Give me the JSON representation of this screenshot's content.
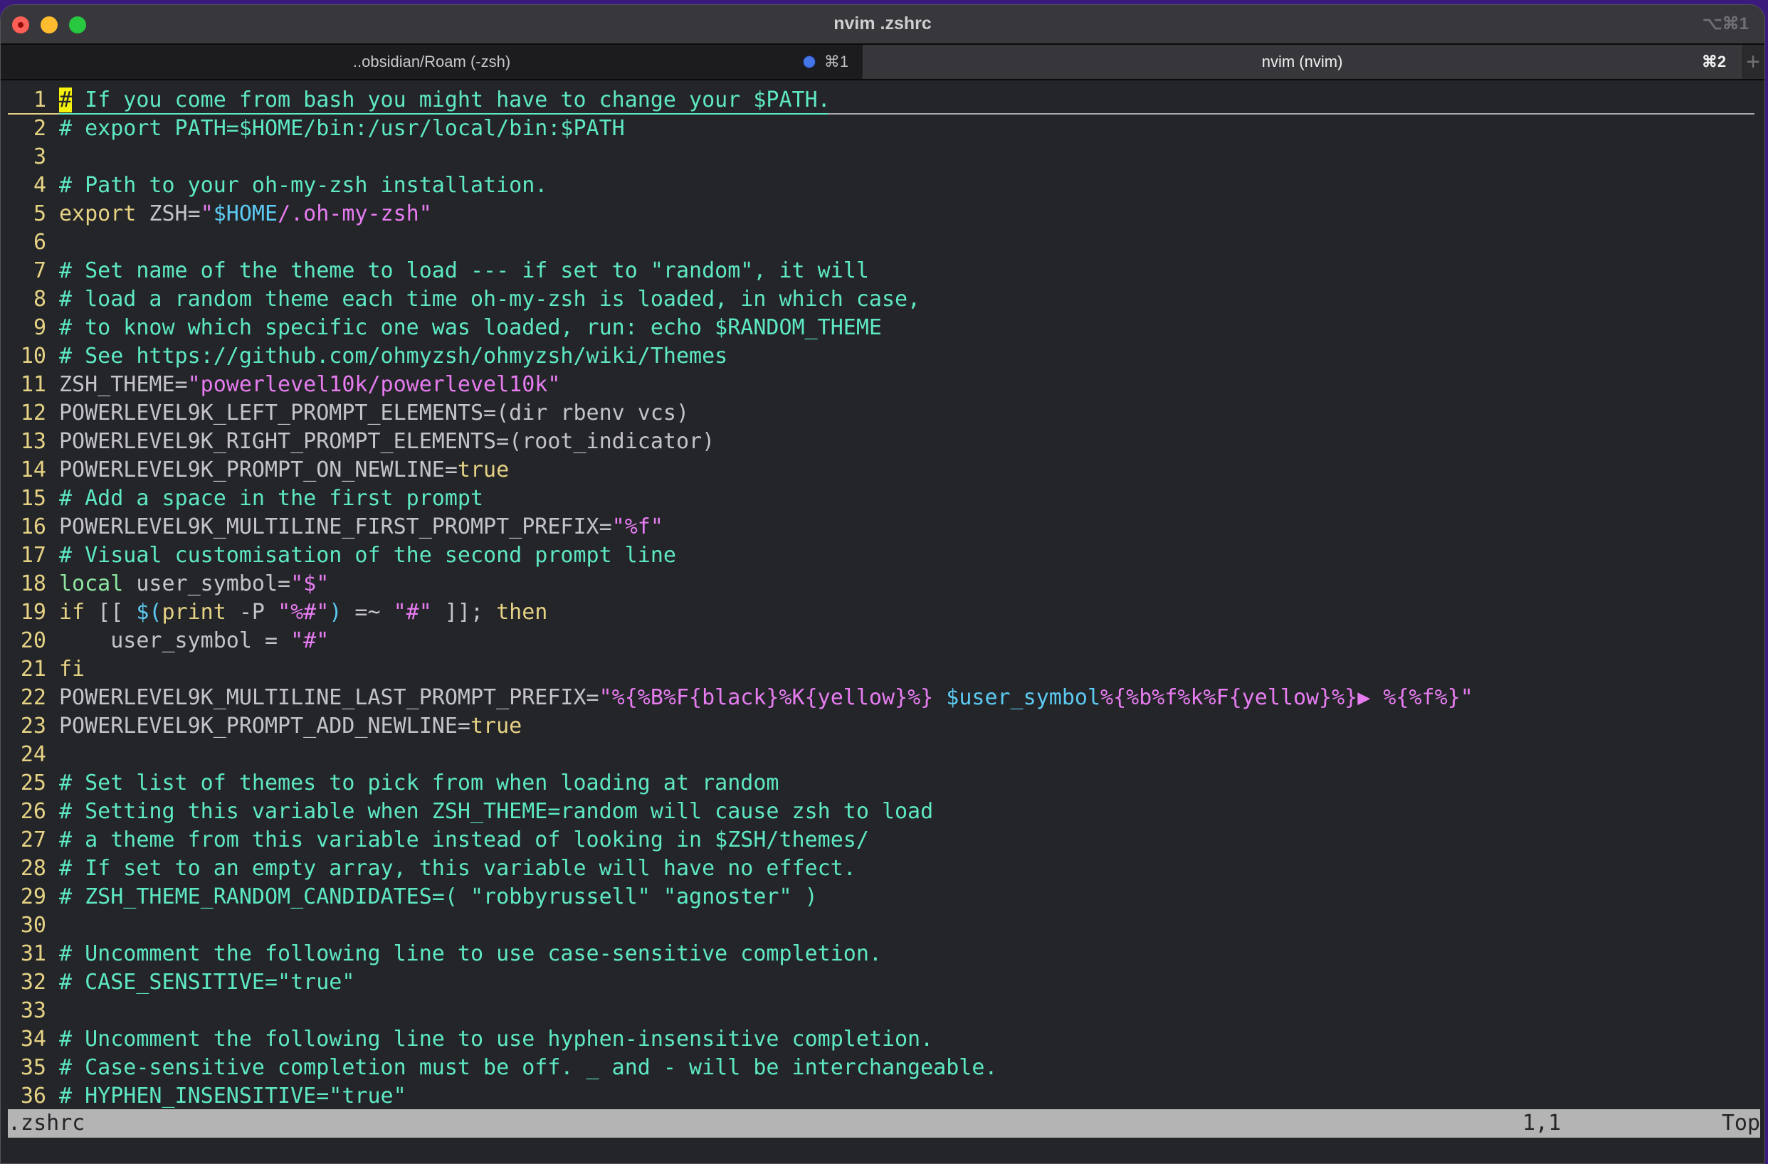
{
  "window": {
    "title": "nvim .zshrc",
    "shortcut": "⌥⌘1"
  },
  "tabs": [
    {
      "label": "..obsidian/Roam (-zsh)",
      "shortcut": "⌘1",
      "has_activity_dot": true,
      "active": false
    },
    {
      "label": "nvim (nvim)",
      "shortcut": "⌘2",
      "active": true
    }
  ],
  "new_tab_label": "+",
  "editor": {
    "cursor": {
      "line": 1,
      "col": 1
    },
    "lines": [
      {
        "n": "1",
        "segs": [
          [
            "cursor",
            "#"
          ],
          [
            "t-comment",
            " If you come from bash you might have to change your $PATH."
          ]
        ]
      },
      {
        "n": "2",
        "segs": [
          [
            "t-comment",
            "# export PATH=$HOME/bin:/usr/local/bin:$PATH"
          ]
        ]
      },
      {
        "n": "3",
        "segs": []
      },
      {
        "n": "4",
        "segs": [
          [
            "t-comment",
            "# Path to your oh-my-zsh installation."
          ]
        ]
      },
      {
        "n": "5",
        "segs": [
          [
            "t-kw",
            "export"
          ],
          [
            "t-plain",
            " ZSH="
          ],
          [
            "t-string",
            "\""
          ],
          [
            "t-var",
            "$HOME"
          ],
          [
            "t-string",
            "/.oh-my-zsh\""
          ]
        ]
      },
      {
        "n": "6",
        "segs": []
      },
      {
        "n": "7",
        "segs": [
          [
            "t-comment",
            "# Set name of the theme to load --- if set to \"random\", it will"
          ]
        ]
      },
      {
        "n": "8",
        "segs": [
          [
            "t-comment",
            "# load a random theme each time oh-my-zsh is loaded, in which case,"
          ]
        ]
      },
      {
        "n": "9",
        "segs": [
          [
            "t-comment",
            "# to know which specific one was loaded, run: echo $RANDOM_THEME"
          ]
        ]
      },
      {
        "n": "10",
        "segs": [
          [
            "t-comment",
            "# See https://github.com/ohmyzsh/ohmyzsh/wiki/Themes"
          ]
        ]
      },
      {
        "n": "11",
        "segs": [
          [
            "t-plain",
            "ZSH_THEME="
          ],
          [
            "t-string",
            "\"powerlevel10k/powerlevel10k\""
          ]
        ]
      },
      {
        "n": "12",
        "segs": [
          [
            "t-plain",
            "POWERLEVEL9K_LEFT_PROMPT_ELEMENTS=(dir rbenv vcs)"
          ]
        ]
      },
      {
        "n": "13",
        "segs": [
          [
            "t-plain",
            "POWERLEVEL9K_RIGHT_PROMPT_ELEMENTS=(root_indicator)"
          ]
        ]
      },
      {
        "n": "14",
        "segs": [
          [
            "t-plain",
            "POWERLEVEL9K_PROMPT_ON_NEWLINE="
          ],
          [
            "t-kw",
            "true"
          ]
        ]
      },
      {
        "n": "15",
        "segs": [
          [
            "t-comment",
            "# Add a space in the first prompt"
          ]
        ]
      },
      {
        "n": "16",
        "segs": [
          [
            "t-plain",
            "POWERLEVEL9K_MULTILINE_FIRST_PROMPT_PREFIX="
          ],
          [
            "t-string",
            "\"%f\""
          ]
        ]
      },
      {
        "n": "17",
        "segs": [
          [
            "t-comment",
            "# Visual customisation of the second prompt line"
          ]
        ]
      },
      {
        "n": "18",
        "segs": [
          [
            "t-local",
            "local"
          ],
          [
            "t-plain",
            " user_symbol="
          ],
          [
            "t-string",
            "\"$\""
          ]
        ]
      },
      {
        "n": "19",
        "segs": [
          [
            "t-kw",
            "if"
          ],
          [
            "t-plain",
            " [[ "
          ],
          [
            "t-var",
            "$("
          ],
          [
            "t-kw",
            "print"
          ],
          [
            "t-plain",
            " -P "
          ],
          [
            "t-string",
            "\"%#\""
          ],
          [
            "t-var",
            ")"
          ],
          [
            "t-plain",
            " =~ "
          ],
          [
            "t-string",
            "\"#\""
          ],
          [
            "t-plain",
            " ]]; "
          ],
          [
            "t-kw",
            "then"
          ]
        ]
      },
      {
        "n": "20",
        "segs": [
          [
            "t-plain",
            "    user_symbol = "
          ],
          [
            "t-string",
            "\"#\""
          ]
        ]
      },
      {
        "n": "21",
        "segs": [
          [
            "t-kw",
            "fi"
          ]
        ]
      },
      {
        "n": "22",
        "segs": [
          [
            "t-plain",
            "POWERLEVEL9K_MULTILINE_LAST_PROMPT_PREFIX="
          ],
          [
            "t-string",
            "\"%{%B%F{black}%K{yellow}%} "
          ],
          [
            "t-var",
            "$user_symbol"
          ],
          [
            "t-string",
            "%{%b%f%k%F{yellow}%}"
          ],
          [
            "t-arrow",
            "▶"
          ],
          [
            "t-string",
            " %{%f%}\""
          ]
        ]
      },
      {
        "n": "23",
        "segs": [
          [
            "t-plain",
            "POWERLEVEL9K_PROMPT_ADD_NEWLINE="
          ],
          [
            "t-kw",
            "true"
          ]
        ]
      },
      {
        "n": "24",
        "segs": []
      },
      {
        "n": "25",
        "segs": [
          [
            "t-comment",
            "# Set list of themes to pick from when loading at random"
          ]
        ]
      },
      {
        "n": "26",
        "segs": [
          [
            "t-comment",
            "# Setting this variable when ZSH_THEME=random will cause zsh to load"
          ]
        ]
      },
      {
        "n": "27",
        "segs": [
          [
            "t-comment",
            "# a theme from this variable instead of looking in $ZSH/themes/"
          ]
        ]
      },
      {
        "n": "28",
        "segs": [
          [
            "t-comment",
            "# If set to an empty array, this variable will have no effect."
          ]
        ]
      },
      {
        "n": "29",
        "segs": [
          [
            "t-comment",
            "# ZSH_THEME_RANDOM_CANDIDATES=( \"robbyrussell\" \"agnoster\" )"
          ]
        ]
      },
      {
        "n": "30",
        "segs": []
      },
      {
        "n": "31",
        "segs": [
          [
            "t-comment",
            "# Uncomment the following line to use case-sensitive completion."
          ]
        ]
      },
      {
        "n": "32",
        "segs": [
          [
            "t-comment",
            "# CASE_SENSITIVE=\"true\""
          ]
        ]
      },
      {
        "n": "33",
        "segs": []
      },
      {
        "n": "34",
        "segs": [
          [
            "t-comment",
            "# Uncomment the following line to use hyphen-insensitive completion."
          ]
        ]
      },
      {
        "n": "35",
        "segs": [
          [
            "t-comment",
            "# Case-sensitive completion must be off. _ and - will be interchangeable."
          ]
        ]
      },
      {
        "n": "36",
        "segs": [
          [
            "t-comment",
            "# HYPHEN_INSENSITIVE=\"true\""
          ]
        ]
      }
    ]
  },
  "statusbar": {
    "filename": ".zshrc",
    "position": "1,1",
    "scroll": "Top"
  },
  "colors": {
    "comment": "#5ee8c4",
    "string": "#e77cf1",
    "variable": "#5ccaf2",
    "keyword": "#e6d285",
    "line_number": "#e6d285",
    "cursor": "#f5f00c",
    "background": "#232528",
    "statusbar": "#b4b4b4"
  }
}
